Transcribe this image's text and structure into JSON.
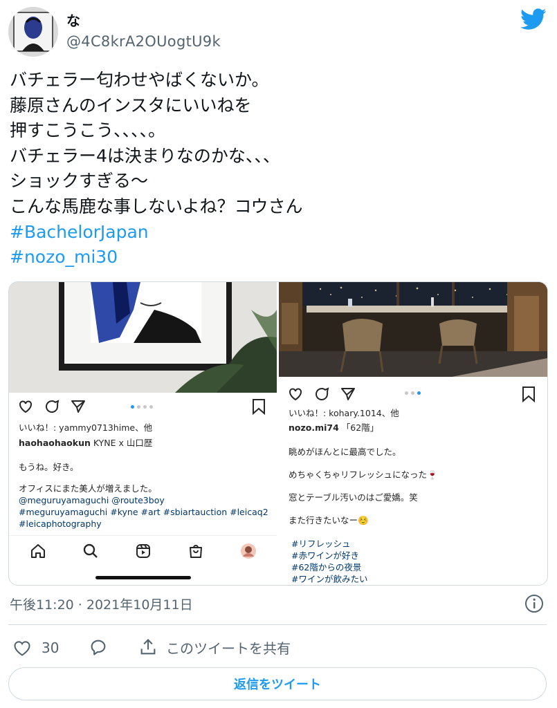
{
  "tweet": {
    "author": {
      "display_name": "な",
      "handle": "@4C8krA2OUogtU9k",
      "avatar_icon": "avatar-portrait",
      "brand_icon": "twitter-bird-icon"
    },
    "text_lines": [
      "バチェラー匂わせやばくないか。",
      "藤原さんのインスタにいいねを",
      "押すこうこう、、、、。",
      "バチェラー4は決まりなのかな、、、",
      "ショックすぎる〜",
      "こんな馬鹿な事しないよね？コウさん"
    ],
    "hashtags": [
      "#BachelorJapan",
      "#nozo_mi30"
    ],
    "timestamp": "午後11:20 · 2021年10月11日",
    "like_count": "30",
    "share_label": "このツイートを共有",
    "reply_button": "返信をツイート",
    "colors": {
      "accent": "#1d9bf0",
      "muted": "#536471",
      "text": "#0f1419"
    }
  },
  "media": {
    "left_post": {
      "liked_by": "いいね！: yammy0713hime、他",
      "caption_user": "haohaohaokun",
      "caption_rest": " KYNE x 山口歴",
      "lines": [
        "もうね。好き。",
        "オフィスにまた美人が増えました。"
      ],
      "mentions": "@meguruyamaguchi @route3boy",
      "hashtags_1": "#meguruyamaguchi #kyne #art #sbiartauction #leicaq2",
      "hashtags_2": "#leicaphotography",
      "nav_icons": [
        "home-icon",
        "search-icon",
        "reels-icon",
        "shop-icon",
        "profile-avatar"
      ]
    },
    "right_post": {
      "liked_by": "いいね！: kohary.1014、他",
      "caption_user": "nozo.mi74",
      "caption_rest": " 「62階」",
      "lines": [
        "眺めがほんとに最高でした。",
        "めちゃくちゃリフレッシュになった🍷",
        "窓とテーブル汚いのはご愛嬌。笑",
        "また行きたいなー☺️"
      ],
      "hashtags": [
        "#リフレッシュ",
        "#赤ワインが好き",
        "#62階からの夜景",
        "#ワインが飲みたい"
      ]
    }
  }
}
